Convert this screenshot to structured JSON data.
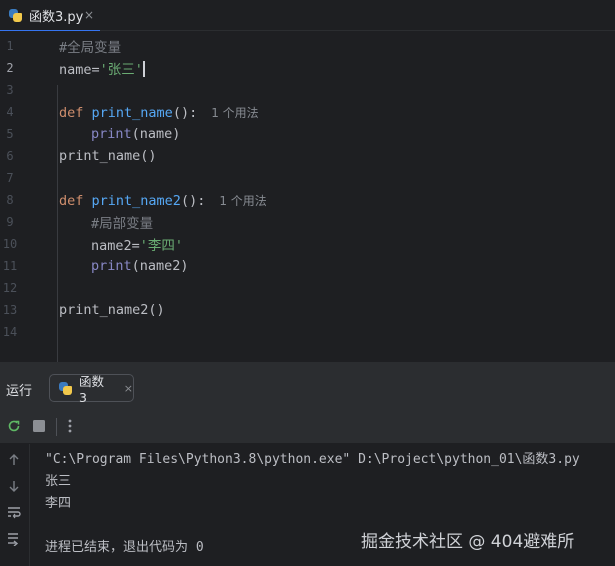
{
  "editor_tab": {
    "label": "函数3.py",
    "close": "×"
  },
  "code_lines": [
    {
      "n": "1",
      "text": "#全局变量"
    },
    {
      "n": "2",
      "text": "name='张三'"
    },
    {
      "n": "3",
      "text": ""
    },
    {
      "n": "4",
      "text": "def print_name():",
      "hint": "1 个用法"
    },
    {
      "n": "5",
      "text": "print(name)"
    },
    {
      "n": "6",
      "text": "print_name()"
    },
    {
      "n": "7",
      "text": ""
    },
    {
      "n": "8",
      "text": "def print_name2():",
      "hint": "1 个用法"
    },
    {
      "n": "9",
      "text": "#局部变量"
    },
    {
      "n": "10",
      "text": "name2='李四'"
    },
    {
      "n": "11",
      "text": "print(name2)"
    },
    {
      "n": "12",
      "text": ""
    },
    {
      "n": "13",
      "text": "print_name2()"
    },
    {
      "n": "14",
      "text": ""
    }
  ],
  "current_line": "2",
  "run_panel": {
    "title": "运行",
    "tab_label": "函数3",
    "tab_close": "×"
  },
  "console": {
    "command": "\"C:\\Program Files\\Python3.8\\python.exe\" D:\\Project\\python_01\\函数3.py",
    "lines": [
      "张三",
      "李四"
    ],
    "exit_message": "进程已结束，退出代码为 0"
  },
  "watermark": "掘金技术社区 @ 404避难所",
  "colors": {
    "background": "#1e1f22",
    "panel": "#2b2d30",
    "keyword": "#cf8e6d",
    "function": "#56a8f5",
    "string": "#6aab73",
    "comment": "#7a7e85",
    "accent": "#3574f0"
  }
}
